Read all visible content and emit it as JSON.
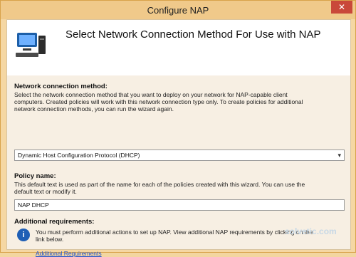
{
  "window": {
    "title": "Configure NAP",
    "close_icon": "close-icon"
  },
  "header": {
    "title": "Select Network Connection Method For Use with NAP",
    "icon": "computer-network-icon"
  },
  "section_network": {
    "label": "Network connection method:",
    "description_line1": "Select the network connection method that you want to deploy on your network for NAP-capable client",
    "description_line2": "computers. Created policies will work with this network connection type only. To create policies for additional",
    "description_line3": "network connection methods, you can run the wizard again.",
    "selected": "Dynamic Host Configuration Protocol (DHCP)"
  },
  "section_policy": {
    "label": "Policy name:",
    "description_line1": "This default text is used as part of the name for each of the policies created with this wizard. You can use the",
    "description_line2": "default text or modify it.",
    "value": "NAP DHCP"
  },
  "section_additional": {
    "label": "Additional requirements:",
    "description_line1": "You must perform additional actions to set up NAP. View additional NAP requirements by clicking on the",
    "description_line2": "link below.",
    "link": "Additional Requirements",
    "icon": "info-icon"
  },
  "watermark": {
    "text": "solvetic.com"
  }
}
